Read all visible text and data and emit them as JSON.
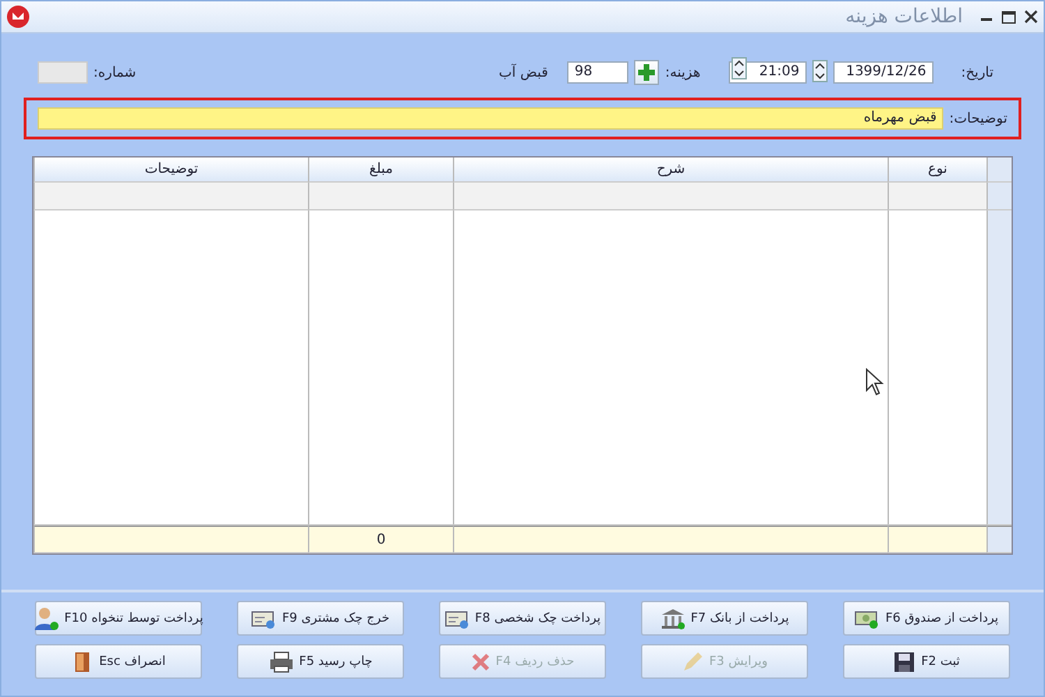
{
  "window": {
    "title": "اطلاعات هزینه"
  },
  "form": {
    "date_label": "تاریخ:",
    "date": "1399/12/26",
    "time": "21:09",
    "expense_label": "هزینه:",
    "expense_code": "98",
    "expense_name": "قبض آب",
    "number_label": "شماره:",
    "description_label": "توضیحات:",
    "description": "قبض مهرماه"
  },
  "table": {
    "columns": [
      "نوع",
      "شرح",
      "مبلغ",
      "توضیحات"
    ],
    "total_amount": "0"
  },
  "buttons": [
    [
      {
        "label": "پرداخت از صندوق F6",
        "kind": "cash",
        "disabled": false
      },
      {
        "label": "پرداخت از بانک F7",
        "kind": "bank",
        "disabled": false
      },
      {
        "label": "پرداخت چک شخصی F8",
        "kind": "cheque",
        "disabled": false
      },
      {
        "label": "خرج چک مشتری F9",
        "kind": "cheque",
        "disabled": false
      },
      {
        "label": "پرداخت توسط تنخواه F10",
        "kind": "person",
        "disabled": false
      }
    ],
    [
      {
        "label": "ثبت F2",
        "kind": "save",
        "disabled": false
      },
      {
        "label": "ویرایش F3",
        "kind": "edit",
        "disabled": true
      },
      {
        "label": "حذف ردیف F4",
        "kind": "delete",
        "disabled": true
      },
      {
        "label": "چاپ رسید F5",
        "kind": "print",
        "disabled": false
      },
      {
        "label": "انصراف Esc",
        "kind": "exit",
        "disabled": false
      }
    ]
  ]
}
